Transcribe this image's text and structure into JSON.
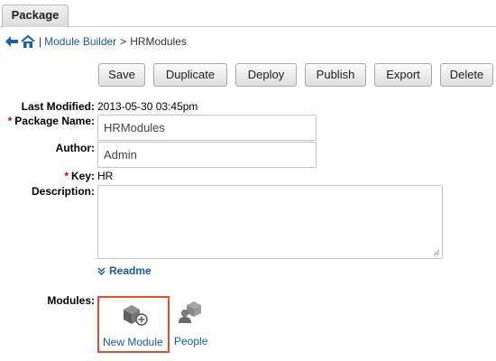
{
  "tabs": {
    "active": "Package"
  },
  "breadcrumb": {
    "back_icon": "arrow-left-icon",
    "home_icon": "home-icon",
    "separator": "|",
    "link": "Module Builder",
    "gt": ">",
    "current": "HRModules"
  },
  "toolbar": {
    "save": "Save",
    "duplicate": "Duplicate",
    "deploy": "Deploy",
    "publish": "Publish",
    "export": "Export",
    "delete": "Delete"
  },
  "form": {
    "last_modified_label": "Last Modified:",
    "last_modified_value": "2013-05-30 03:45pm",
    "required_mark": "*",
    "package_name_label": "Package Name:",
    "package_name_value": "HRModules",
    "author_label": "Author:",
    "author_value": "Admin",
    "key_label": "Key:",
    "key_value": "HR",
    "description_label": "Description:",
    "description_value": ""
  },
  "readme": {
    "label": "Readme",
    "icon": "chevron-down-icon"
  },
  "modules": {
    "label": "Modules:",
    "items": [
      {
        "label": "New Module",
        "icon": "new-module-icon"
      },
      {
        "label": "People",
        "icon": "people-icon"
      }
    ]
  },
  "colors": {
    "link": "#1a5a9b",
    "required": "#d40000",
    "highlight": "#e34a33"
  }
}
